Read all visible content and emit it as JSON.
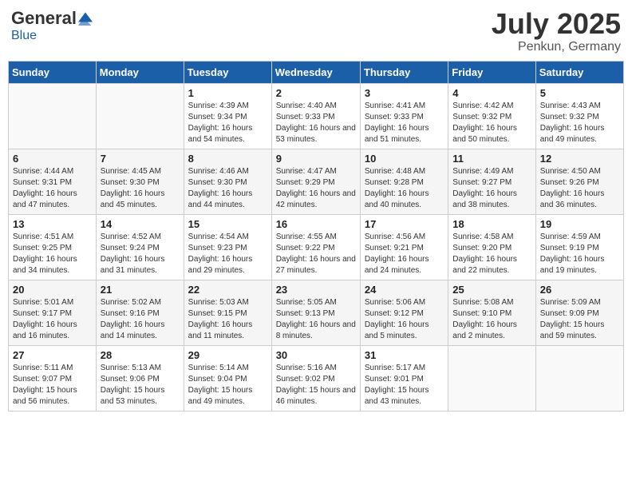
{
  "logo": {
    "general": "General",
    "blue": "Blue"
  },
  "header": {
    "month": "July 2025",
    "location": "Penkun, Germany"
  },
  "weekdays": [
    "Sunday",
    "Monday",
    "Tuesday",
    "Wednesday",
    "Thursday",
    "Friday",
    "Saturday"
  ],
  "weeks": [
    [
      {
        "day": "",
        "info": ""
      },
      {
        "day": "",
        "info": ""
      },
      {
        "day": "1",
        "info": "Sunrise: 4:39 AM\nSunset: 9:34 PM\nDaylight: 16 hours and 54 minutes."
      },
      {
        "day": "2",
        "info": "Sunrise: 4:40 AM\nSunset: 9:33 PM\nDaylight: 16 hours and 53 minutes."
      },
      {
        "day": "3",
        "info": "Sunrise: 4:41 AM\nSunset: 9:33 PM\nDaylight: 16 hours and 51 minutes."
      },
      {
        "day": "4",
        "info": "Sunrise: 4:42 AM\nSunset: 9:32 PM\nDaylight: 16 hours and 50 minutes."
      },
      {
        "day": "5",
        "info": "Sunrise: 4:43 AM\nSunset: 9:32 PM\nDaylight: 16 hours and 49 minutes."
      }
    ],
    [
      {
        "day": "6",
        "info": "Sunrise: 4:44 AM\nSunset: 9:31 PM\nDaylight: 16 hours and 47 minutes."
      },
      {
        "day": "7",
        "info": "Sunrise: 4:45 AM\nSunset: 9:30 PM\nDaylight: 16 hours and 45 minutes."
      },
      {
        "day": "8",
        "info": "Sunrise: 4:46 AM\nSunset: 9:30 PM\nDaylight: 16 hours and 44 minutes."
      },
      {
        "day": "9",
        "info": "Sunrise: 4:47 AM\nSunset: 9:29 PM\nDaylight: 16 hours and 42 minutes."
      },
      {
        "day": "10",
        "info": "Sunrise: 4:48 AM\nSunset: 9:28 PM\nDaylight: 16 hours and 40 minutes."
      },
      {
        "day": "11",
        "info": "Sunrise: 4:49 AM\nSunset: 9:27 PM\nDaylight: 16 hours and 38 minutes."
      },
      {
        "day": "12",
        "info": "Sunrise: 4:50 AM\nSunset: 9:26 PM\nDaylight: 16 hours and 36 minutes."
      }
    ],
    [
      {
        "day": "13",
        "info": "Sunrise: 4:51 AM\nSunset: 9:25 PM\nDaylight: 16 hours and 34 minutes."
      },
      {
        "day": "14",
        "info": "Sunrise: 4:52 AM\nSunset: 9:24 PM\nDaylight: 16 hours and 31 minutes."
      },
      {
        "day": "15",
        "info": "Sunrise: 4:54 AM\nSunset: 9:23 PM\nDaylight: 16 hours and 29 minutes."
      },
      {
        "day": "16",
        "info": "Sunrise: 4:55 AM\nSunset: 9:22 PM\nDaylight: 16 hours and 27 minutes."
      },
      {
        "day": "17",
        "info": "Sunrise: 4:56 AM\nSunset: 9:21 PM\nDaylight: 16 hours and 24 minutes."
      },
      {
        "day": "18",
        "info": "Sunrise: 4:58 AM\nSunset: 9:20 PM\nDaylight: 16 hours and 22 minutes."
      },
      {
        "day": "19",
        "info": "Sunrise: 4:59 AM\nSunset: 9:19 PM\nDaylight: 16 hours and 19 minutes."
      }
    ],
    [
      {
        "day": "20",
        "info": "Sunrise: 5:01 AM\nSunset: 9:17 PM\nDaylight: 16 hours and 16 minutes."
      },
      {
        "day": "21",
        "info": "Sunrise: 5:02 AM\nSunset: 9:16 PM\nDaylight: 16 hours and 14 minutes."
      },
      {
        "day": "22",
        "info": "Sunrise: 5:03 AM\nSunset: 9:15 PM\nDaylight: 16 hours and 11 minutes."
      },
      {
        "day": "23",
        "info": "Sunrise: 5:05 AM\nSunset: 9:13 PM\nDaylight: 16 hours and 8 minutes."
      },
      {
        "day": "24",
        "info": "Sunrise: 5:06 AM\nSunset: 9:12 PM\nDaylight: 16 hours and 5 minutes."
      },
      {
        "day": "25",
        "info": "Sunrise: 5:08 AM\nSunset: 9:10 PM\nDaylight: 16 hours and 2 minutes."
      },
      {
        "day": "26",
        "info": "Sunrise: 5:09 AM\nSunset: 9:09 PM\nDaylight: 15 hours and 59 minutes."
      }
    ],
    [
      {
        "day": "27",
        "info": "Sunrise: 5:11 AM\nSunset: 9:07 PM\nDaylight: 15 hours and 56 minutes."
      },
      {
        "day": "28",
        "info": "Sunrise: 5:13 AM\nSunset: 9:06 PM\nDaylight: 15 hours and 53 minutes."
      },
      {
        "day": "29",
        "info": "Sunrise: 5:14 AM\nSunset: 9:04 PM\nDaylight: 15 hours and 49 minutes."
      },
      {
        "day": "30",
        "info": "Sunrise: 5:16 AM\nSunset: 9:02 PM\nDaylight: 15 hours and 46 minutes."
      },
      {
        "day": "31",
        "info": "Sunrise: 5:17 AM\nSunset: 9:01 PM\nDaylight: 15 hours and 43 minutes."
      },
      {
        "day": "",
        "info": ""
      },
      {
        "day": "",
        "info": ""
      }
    ]
  ]
}
